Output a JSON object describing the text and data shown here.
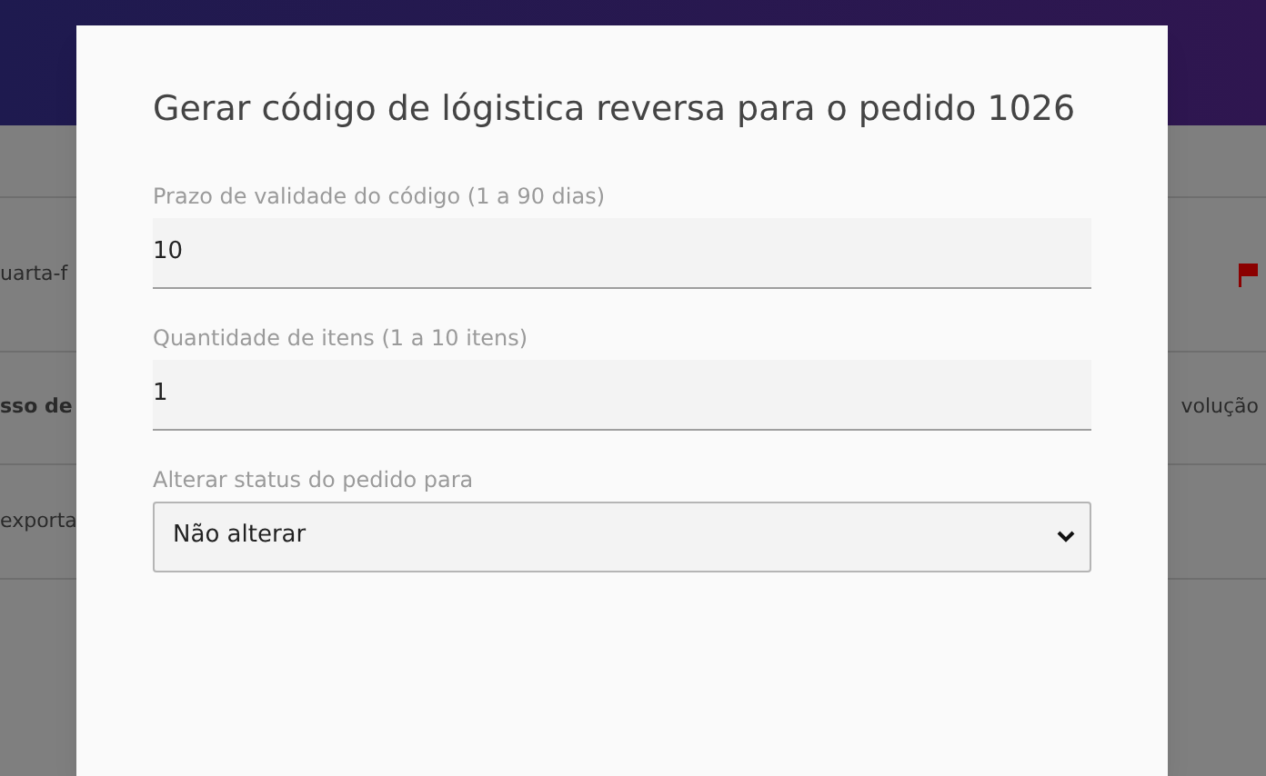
{
  "background": {
    "rows": [
      {
        "kind": "flag",
        "left": "uarta-f",
        "left_bold": false
      },
      {
        "kind": "text",
        "left": "sso de",
        "left_bold": true,
        "right": "volução"
      },
      {
        "kind": "plain",
        "left": "exporta",
        "left_bold": false
      }
    ]
  },
  "dialog": {
    "title": "Gerar código de lógistica reversa para o pedido 1026",
    "fields": [
      {
        "kind": "input",
        "label": "Prazo de validade do código (1 a 90 dias)",
        "value": "10"
      },
      {
        "kind": "input",
        "label": "Quantidade de itens (1 a 10 itens)",
        "value": "1"
      },
      {
        "kind": "select",
        "label": "Alterar status do pedido para",
        "value": "Não alterar"
      }
    ]
  }
}
